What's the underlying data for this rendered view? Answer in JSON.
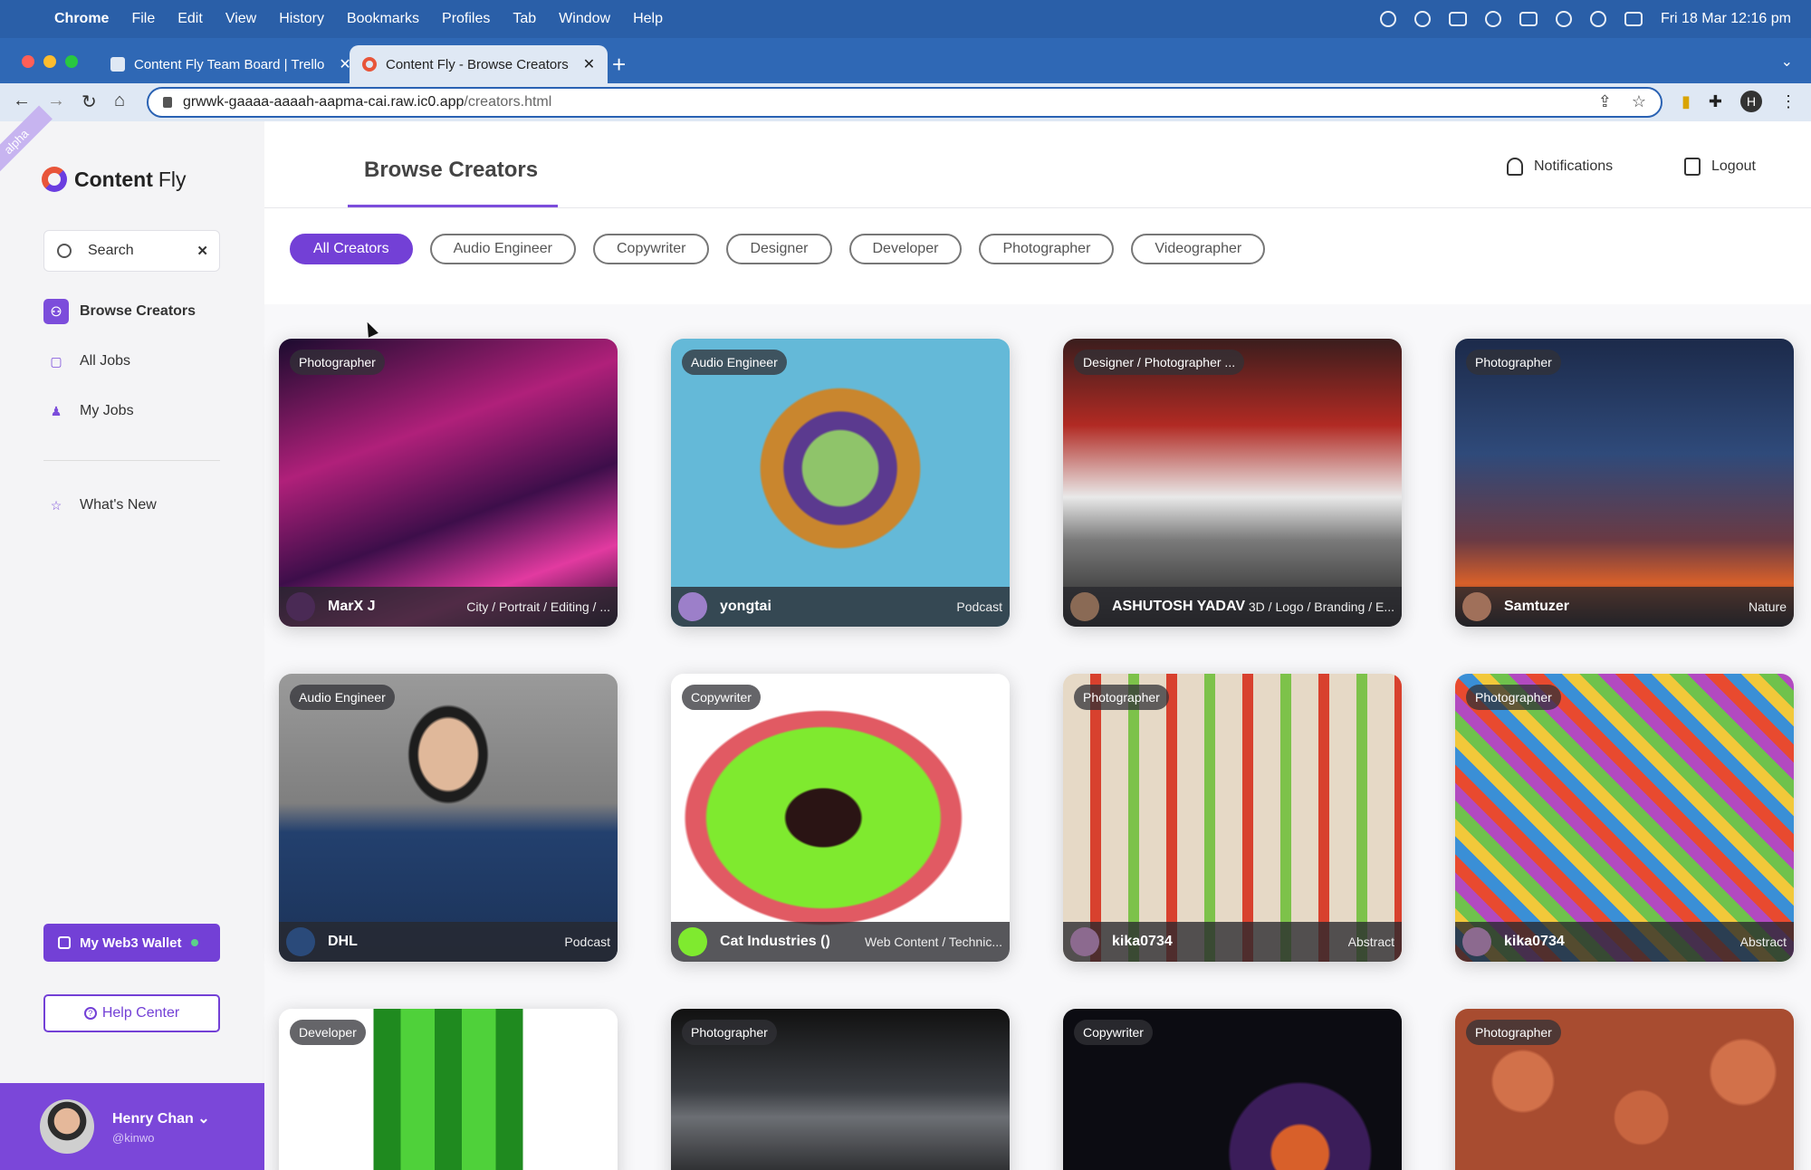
{
  "menubar": {
    "app": "Chrome",
    "items": [
      "File",
      "Edit",
      "View",
      "History",
      "Bookmarks",
      "Profiles",
      "Tab",
      "Window",
      "Help"
    ],
    "clock": "Fri 18 Mar  12:16 pm"
  },
  "browser": {
    "tabs": [
      {
        "title": "Content Fly Team Board | Trello"
      },
      {
        "title": "Content Fly - Browse Creators"
      }
    ],
    "url_host": "grwwk-gaaaa-aaaah-aapma-cai.raw.ic0.app",
    "url_path": "/creators.html",
    "profile_initial": "H"
  },
  "sidebar": {
    "ribbon": "alpha",
    "logo_bold": "Content",
    "logo_light": "Fly",
    "search_placeholder": "Search",
    "nav": [
      {
        "label": "Browse Creators"
      },
      {
        "label": "All Jobs"
      },
      {
        "label": "My Jobs"
      }
    ],
    "whats_new": "What's New",
    "wallet_label": "My Web3 Wallet",
    "help_label": "Help Center",
    "user": {
      "name": "Henry Chan",
      "handle": "@kinwo"
    }
  },
  "main": {
    "title": "Browse Creators",
    "notifications": "Notifications",
    "logout": "Logout",
    "filters": [
      "All Creators",
      "Audio Engineer",
      "Copywriter",
      "Designer",
      "Developer",
      "Photographer",
      "Videographer"
    ],
    "cards": [
      {
        "role": "Photographer",
        "name": "MarX J",
        "tags": "City / Portrait / Editing / ..."
      },
      {
        "role": "Audio Engineer",
        "name": "yongtai",
        "tags": "Podcast"
      },
      {
        "role": "Designer / Photographer ...",
        "name": "ASHUTOSH YADAV",
        "tags": "3D / Logo / Branding / E..."
      },
      {
        "role": "Photographer",
        "name": "Samtuzer",
        "tags": "Nature"
      },
      {
        "role": "Audio Engineer",
        "name": "DHL",
        "tags": "Podcast"
      },
      {
        "role": "Copywriter",
        "name": "Cat Industries ()",
        "tags": "Web Content / Technic..."
      },
      {
        "role": "Photographer",
        "name": "kika0734",
        "tags": "Abstract"
      },
      {
        "role": "Photographer",
        "name": "kika0734",
        "tags": "Abstract"
      },
      {
        "role": "Developer",
        "name": "",
        "tags": ""
      },
      {
        "role": "Photographer",
        "name": "",
        "tags": ""
      },
      {
        "role": "Copywriter",
        "name": "",
        "tags": ""
      },
      {
        "role": "Photographer",
        "name": "",
        "tags": ""
      }
    ]
  },
  "colors": {
    "brand_purple": "#7340d6",
    "menubar_blue": "#2a5fa8"
  }
}
